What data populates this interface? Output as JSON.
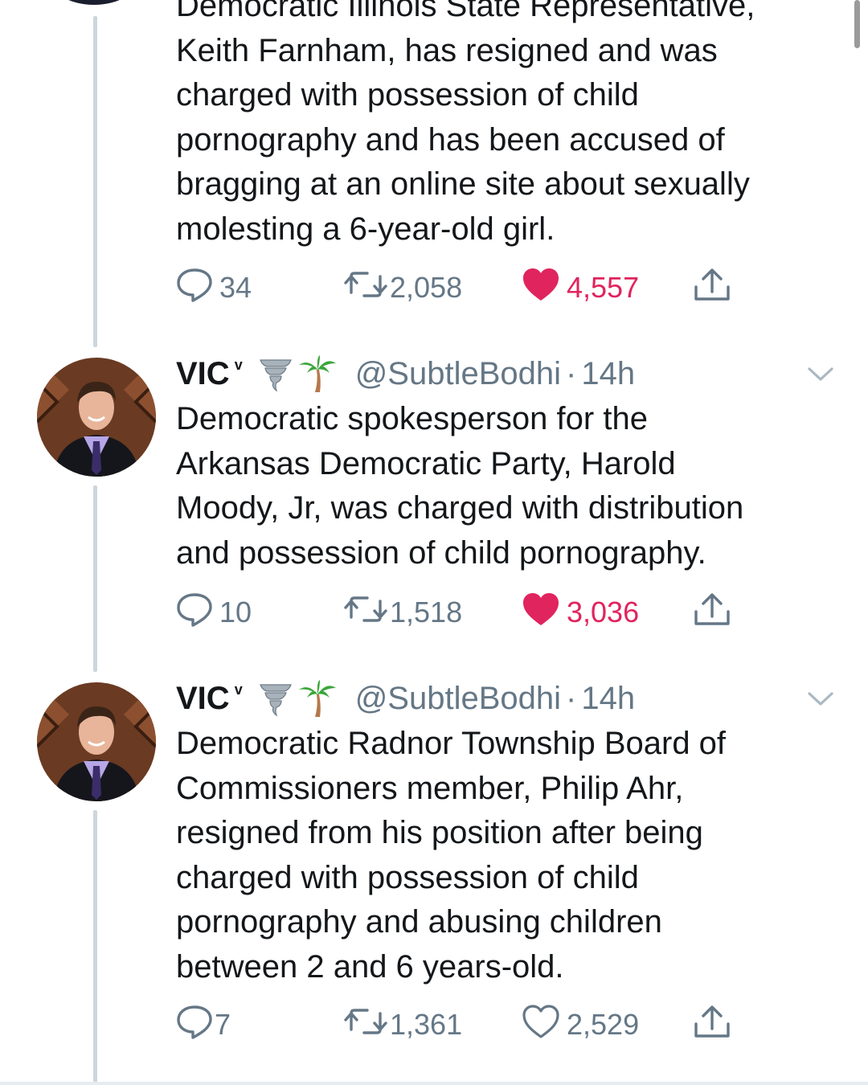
{
  "tweets": [
    {
      "text": "Democratic Illinois State Representative,\nKeith Farnham, has resigned and was\ncharged with possession of child\npornography and has been accused of\nbragging at an online site about sexually\nmolesting a 6-year-old girl.",
      "replies": "34",
      "retweets": "2,058",
      "likes": "4,557",
      "liked": true
    },
    {
      "name": "VIC",
      "verified_mark": "v",
      "handle": "@SubtleBodhi",
      "separator": "·",
      "time": "14h",
      "text": "Democratic spokesperson for the\nArkansas Democratic Party, Harold\nMoody, Jr, was charged with distribution\nand possession of child pornography.",
      "replies": "10",
      "retweets": "1,518",
      "likes": "3,036",
      "liked": true
    },
    {
      "name": "VIC",
      "verified_mark": "v",
      "handle": "@SubtleBodhi",
      "separator": "·",
      "time": "14h",
      "text": "Democratic Radnor Township Board of\nCommissioners member, Philip Ahr,\nresigned from his position after being\ncharged with possession of child\npornography and abusing children\nbetween 2 and 6 years-old.",
      "replies": "7",
      "retweets": "1,361",
      "likes": "2,529",
      "liked": false
    }
  ],
  "icons": {
    "reply": "reply-icon",
    "retweet": "retweet-icon",
    "like": "heart-icon",
    "share": "share-icon",
    "tornado": "tornado-emoji",
    "palm": "palm-tree-emoji",
    "menu": "chevron-down-icon"
  },
  "colors": {
    "text": "#14171a",
    "muted": "#657786",
    "like": "#e0245e",
    "thread_line": "#ccd6dd"
  }
}
